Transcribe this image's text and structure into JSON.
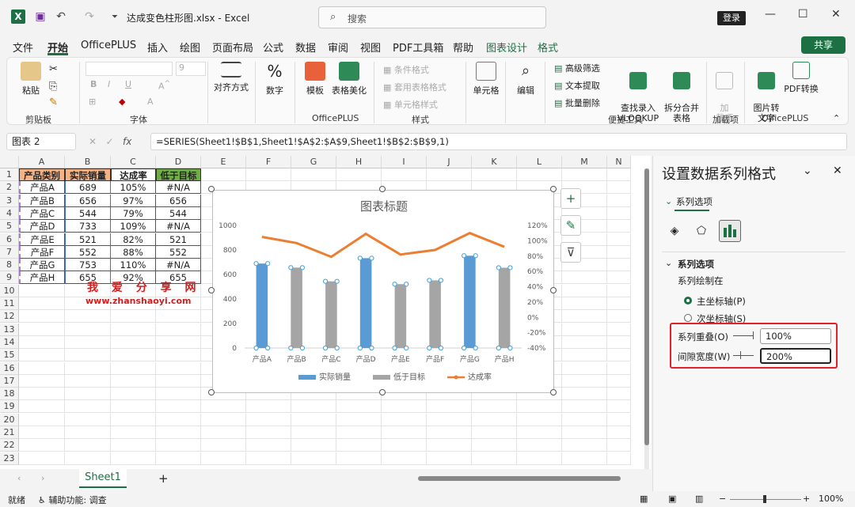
{
  "titlebar": {
    "filename": "达成变色柱形图.xlsx  -  Excel",
    "search_placeholder": "搜索",
    "login": "登录",
    "app_icon_glyph": "X",
    "undo_glyph": "↶",
    "redo_glyph": "↷",
    "save_glyph": "▣",
    "qat_glyph": "⏷",
    "minimize_glyph": "—",
    "maximize_glyph": "☐",
    "close_glyph": "✕",
    "search_glyph": "⌕"
  },
  "menu": {
    "items": [
      "文件",
      "开始",
      "OfficePLUS",
      "插入",
      "绘图",
      "页面布局",
      "公式",
      "数据",
      "审阅",
      "视图",
      "PDF工具箱",
      "帮助",
      "图表设计",
      "格式"
    ],
    "share": "共享"
  },
  "ribbon": {
    "clipboard": {
      "paste": "粘贴",
      "label": "剪贴板"
    },
    "font": {
      "label": "字体",
      "size": "9"
    },
    "align": {
      "label": "对齐方式"
    },
    "number": {
      "label": "数字"
    },
    "officeplus": {
      "template": "模板",
      "beautify": "表格美化",
      "label": "OfficePLUS"
    },
    "styles": {
      "cond": "条件格式",
      "table": "套用表格格式",
      "cell": "单元格样式",
      "label": "样式"
    },
    "cells": {
      "label": "单元格"
    },
    "edit": {
      "label": "编辑"
    },
    "tools": {
      "filter": "高级筛选",
      "text": "文本提取",
      "bulkdel": "批量删除",
      "vlookup": "查找录入\nVLOOKUP",
      "split": "拆分合并\n表格",
      "label": "便捷工具"
    },
    "addins": {
      "addin": "加\n载项",
      "label": "加载项"
    },
    "officeplus2": {
      "img2text": "图片转\n文字",
      "pdf": "PDF转换",
      "label": "OfficePLUS"
    }
  },
  "formula_bar": {
    "namebox": "图表 2",
    "fx": "fx",
    "formula": "=SERIES(Sheet1!$B$1,Sheet1!$A$2:$A$9,Sheet1!$B$2:$B$9,1)"
  },
  "grid": {
    "columns": [
      "A",
      "B",
      "C",
      "D",
      "E",
      "F",
      "G",
      "H",
      "I",
      "J",
      "K",
      "L",
      "M",
      "N"
    ],
    "rows": [
      "1",
      "2",
      "3",
      "4",
      "5",
      "6",
      "7",
      "8",
      "9",
      "10",
      "11",
      "12",
      "13",
      "14",
      "15",
      "16",
      "17",
      "18",
      "19",
      "20",
      "21",
      "22",
      "23"
    ],
    "header": [
      "产品类别",
      "实际销量",
      "达成率",
      "低于目标"
    ],
    "data": [
      [
        "产品A",
        "689",
        "105%",
        "#N/A"
      ],
      [
        "产品B",
        "656",
        "97%",
        "656"
      ],
      [
        "产品C",
        "544",
        "79%",
        "544"
      ],
      [
        "产品D",
        "733",
        "109%",
        "#N/A"
      ],
      [
        "产品E",
        "521",
        "82%",
        "521"
      ],
      [
        "产品F",
        "552",
        "88%",
        "552"
      ],
      [
        "产品G",
        "753",
        "110%",
        "#N/A"
      ],
      [
        "产品H",
        "655",
        "92%",
        "655"
      ]
    ],
    "watermark_cn": "我 爱 分 享 网",
    "watermark_url": "www.zhanshaoyi.com"
  },
  "chart_data": {
    "type": "bar",
    "title": "图表标题",
    "categories": [
      "产品A",
      "产品B",
      "产品C",
      "产品D",
      "产品E",
      "产品F",
      "产品G",
      "产品H"
    ],
    "series": [
      {
        "name": "实际销量",
        "kind": "bar",
        "values": [
          689,
          null,
          null,
          733,
          null,
          null,
          753,
          null
        ],
        "color": "#5b9bd5"
      },
      {
        "name": "低于目标",
        "kind": "bar",
        "values": [
          null,
          656,
          544,
          null,
          521,
          552,
          null,
          655
        ],
        "color": "#a5a5a5"
      },
      {
        "name": "达成率",
        "kind": "line",
        "axis": "secondary",
        "values": [
          1.05,
          0.97,
          0.79,
          1.09,
          0.82,
          0.88,
          1.1,
          0.92
        ],
        "color": "#ed7d31"
      }
    ],
    "ylim": [
      0,
      1000
    ],
    "yticks": [
      "0",
      "200",
      "400",
      "600",
      "800",
      "1000"
    ],
    "y2lim": [
      -0.4,
      1.2
    ],
    "y2ticks": [
      "-40%",
      "-20%",
      "0%",
      "20%",
      "40%",
      "60%",
      "80%",
      "100%",
      "120%"
    ],
    "legend": "bottom",
    "grid": false
  },
  "sheet": {
    "tab": "Sheet1",
    "add": "+"
  },
  "status": {
    "ready": "就绪",
    "accessibility": "辅助功能: 调查",
    "zoom": "100%"
  },
  "pane": {
    "title": "设置数据系列格式",
    "tab": "系列选项",
    "section": "系列选项",
    "plot_on": "系列绘制在",
    "primary": "主坐标轴(P)",
    "secondary": "次坐标轴(S)",
    "overlap_label": "系列重叠(O)",
    "overlap_value": "100%",
    "gap_label": "间隙宽度(W)",
    "gap_value": "200%"
  },
  "colors": {
    "accent": "#1d7044",
    "highlight": "#e0202a"
  }
}
